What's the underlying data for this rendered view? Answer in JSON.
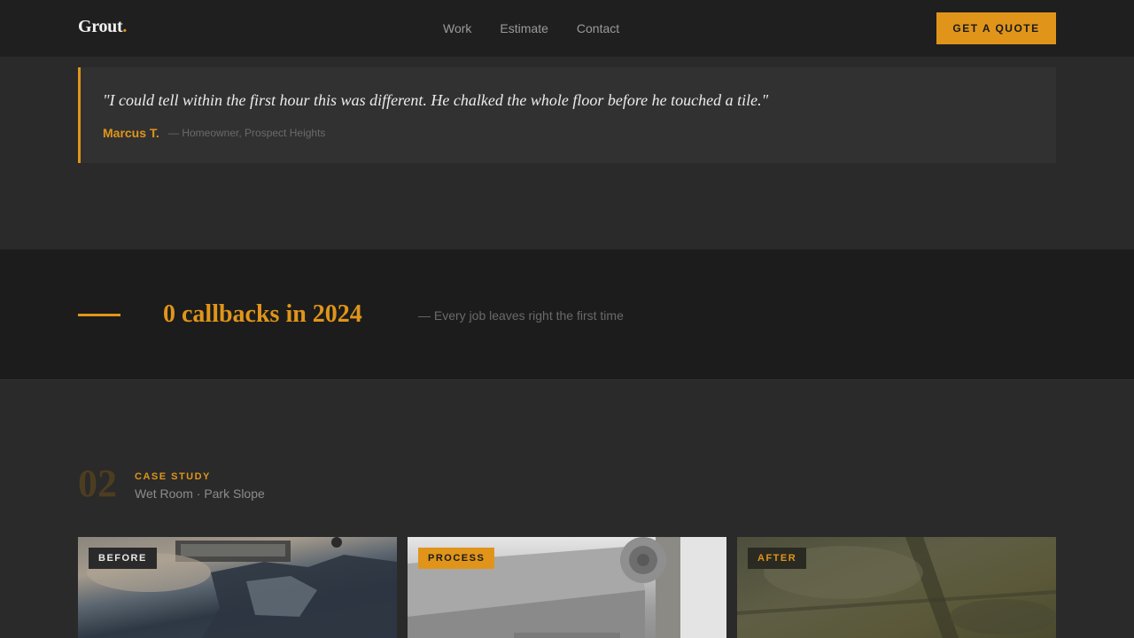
{
  "brand": {
    "name": "Grout",
    "dot": ".",
    "accent": "#e0951a"
  },
  "nav": {
    "items": [
      "Work",
      "Estimate",
      "Contact"
    ]
  },
  "header": {
    "cta_label": "GET A QUOTE"
  },
  "testimonial": {
    "quote": "\"I could tell within the first hour this was different. He chalked the whole floor before he touched a tile.\"",
    "author": "Marcus T.",
    "role": "— Homeowner, Prospect Heights"
  },
  "stat": {
    "value": "0 callbacks in 2024",
    "note": "— Every job leaves right the first time"
  },
  "case_study": {
    "number": "02",
    "label": "CASE STUDY",
    "title": "Wet Room · Park Slope",
    "images": [
      {
        "badge": "BEFORE"
      },
      {
        "badge": "PROCESS"
      },
      {
        "badge": "AFTER"
      }
    ]
  }
}
